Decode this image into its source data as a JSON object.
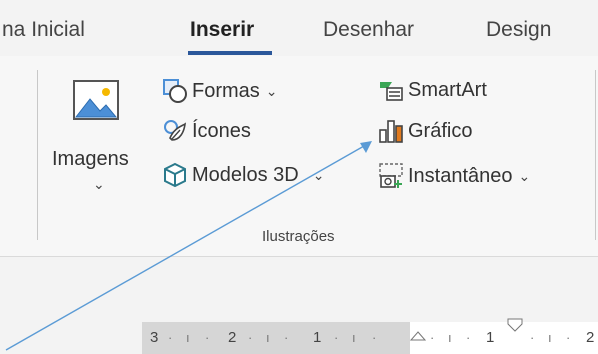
{
  "tabs": {
    "home": "na Inicial",
    "insert": "Inserir",
    "draw": "Desenhar",
    "design": "Design"
  },
  "ribbon": {
    "images": {
      "label": "Imagens"
    },
    "shapes": {
      "label": "Formas"
    },
    "icons": {
      "label": "Ícones"
    },
    "models3d": {
      "label": "Modelos 3D"
    },
    "smartart": {
      "label": "SmartArt"
    },
    "chart": {
      "label": "Gráfico"
    },
    "screenshot": {
      "label": "Instantâneo"
    },
    "group_label": "Ilustrações"
  },
  "ruler": {
    "numbers": [
      "3",
      "2",
      "1",
      "1",
      "2"
    ]
  },
  "colors": {
    "accent": "#2b579a",
    "arrow": "#5b9bd5",
    "ribbon_bg": "#f7f7f7"
  },
  "icons": [
    "images-icon",
    "shapes-icon",
    "icons-icon",
    "models-3d-icon",
    "smartart-icon",
    "chart-icon",
    "screenshot-icon",
    "chevron-down-icon"
  ]
}
